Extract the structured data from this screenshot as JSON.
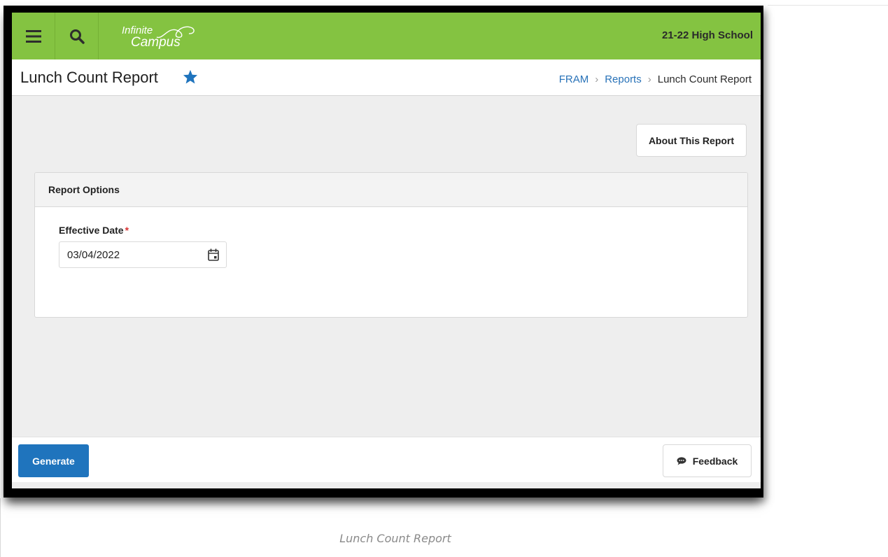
{
  "app": {
    "logo_line1": "Infinite",
    "logo_line2": "Campus",
    "school": "21-22 High School",
    "accent_color": "#84c341",
    "primary_button_color": "#1f74bd",
    "link_color": "#2872b8"
  },
  "header": {
    "menu_icon": "hamburger-menu-icon",
    "search_icon": "search-icon",
    "title": "Lunch Count Report",
    "favorite_icon": "star-icon",
    "breadcrumb": [
      "FRAM",
      "Reports",
      "Lunch Count Report"
    ]
  },
  "actions": {
    "about_label": "About This Report"
  },
  "report_options": {
    "heading": "Report Options",
    "effective_date_label": "Effective Date",
    "required_marker": "*",
    "effective_date_value": "03/04/2022",
    "calendar_icon": "calendar-icon"
  },
  "footer": {
    "generate_label": "Generate",
    "feedback_label": "Feedback",
    "feedback_icon": "speech-bubble-icon"
  },
  "caption": "Lunch Count Report"
}
